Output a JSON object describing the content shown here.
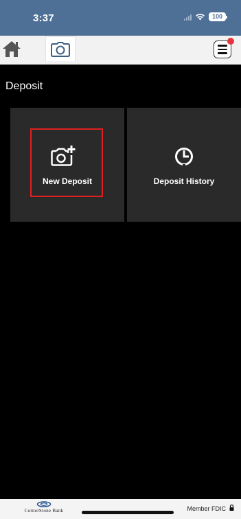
{
  "status_bar": {
    "time": "3:37",
    "battery": "100"
  },
  "toolbar": {
    "icons": [
      "home-icon",
      "camera-icon",
      "menu-icon"
    ]
  },
  "page": {
    "title": "Deposit"
  },
  "tiles": [
    {
      "label": "New Deposit",
      "icon": "camera-plus-icon",
      "highlighted": true
    },
    {
      "label": "Deposit History",
      "icon": "clock-icon",
      "highlighted": false
    }
  ],
  "footer": {
    "bank_name": "CornerStone Bank",
    "member_text": "Member FDIC"
  },
  "colors": {
    "status_bar": "#4e6f96",
    "toolbar": "#f2f2f2",
    "tile": "#2a2a2a",
    "highlight": "#e02020",
    "notification": "#e8343a"
  }
}
